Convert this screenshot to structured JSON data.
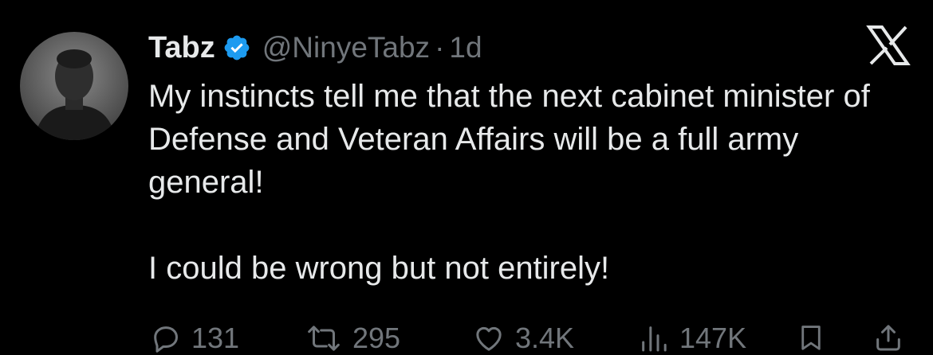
{
  "tweet": {
    "display_name": "Tabz",
    "verified_icon": "verified-badge-icon",
    "handle": "@NinyeTabz",
    "separator": "·",
    "time": "1d",
    "paragraphs": [
      "My instincts tell me that the next cabinet minister of Defense and Veteran Affairs will be a full army general!",
      "I could be wrong but not entirely!"
    ]
  },
  "actions": {
    "replies": "131",
    "reposts": "295",
    "likes": "3.4K",
    "views": "147K"
  },
  "icons": {
    "brand": "x-logo-icon",
    "reply": "reply-bubble-icon",
    "repost": "repost-arrows-icon",
    "like": "heart-icon",
    "views": "bar-chart-icon",
    "bookmark": "bookmark-icon",
    "share": "share-icon"
  },
  "colors": {
    "background": "#000000",
    "primary_text": "#e7e9ea",
    "secondary_text": "#71767b",
    "verified_blue": "#1d9bf0"
  }
}
